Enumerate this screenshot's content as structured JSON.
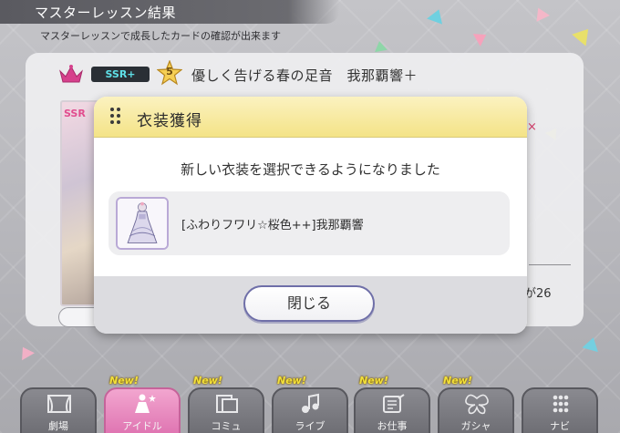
{
  "header": {
    "title": "マスターレッスン結果",
    "subtitle": "マスターレッスンで成長したカードの確認が出来ます"
  },
  "card": {
    "rarity": "SSR+",
    "star_level": "5",
    "name": "優しく告げる春の足音　我那覇響＋",
    "thumb_label": "SSR",
    "partial_text": "が26"
  },
  "modal": {
    "title": "衣装獲得",
    "message": "新しい衣装を選択できるようになりました",
    "reward_name": "[ふわりフワリ☆桜色++]我那覇響",
    "close_label": "閉じる"
  },
  "nav": {
    "new_label": "New!",
    "items": [
      {
        "label": "劇場",
        "icon": "theater-icon",
        "new": false,
        "active": false
      },
      {
        "label": "アイドル",
        "icon": "idol-icon",
        "new": true,
        "active": true
      },
      {
        "label": "コミュ",
        "icon": "commu-icon",
        "new": true,
        "active": false
      },
      {
        "label": "ライブ",
        "icon": "live-music-icon",
        "new": true,
        "active": false
      },
      {
        "label": "お仕事",
        "icon": "work-icon",
        "new": true,
        "active": false
      },
      {
        "label": "ガシャ",
        "icon": "gacha-butterfly-icon",
        "new": true,
        "active": false
      },
      {
        "label": "ナビ",
        "icon": "navi-grid-icon",
        "new": false,
        "active": false
      }
    ]
  },
  "colors": {
    "modal_header": "#f4e387",
    "active_tab": "#de72b0",
    "rarity_text": "#5fe0e8"
  }
}
